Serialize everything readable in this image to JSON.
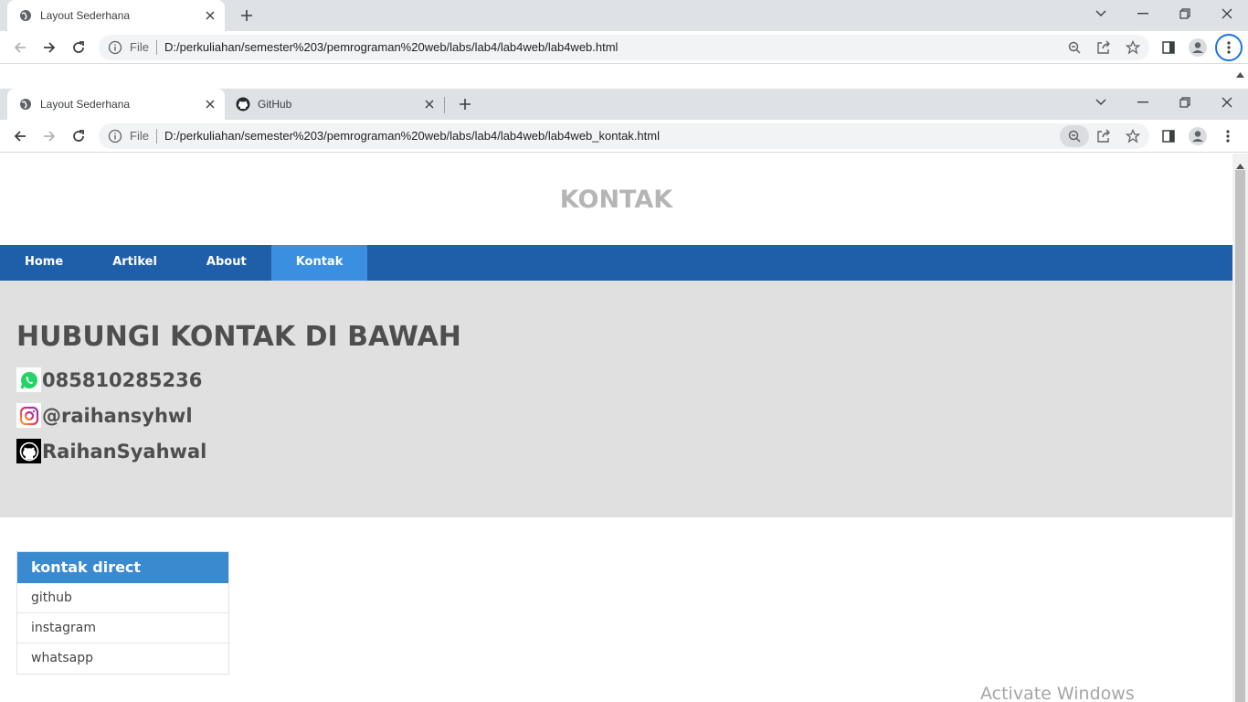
{
  "back_window": {
    "tab_title": "Layout Sederhana",
    "url_scheme": "File",
    "url": "D:/perkuliahan/semester%203/pemrograman%20web/labs/lab4/lab4web/lab4web.html"
  },
  "front_window": {
    "tabs": [
      {
        "title": "Layout Sederhana",
        "active": true,
        "icon": "globe-icon"
      },
      {
        "title": "GitHub",
        "active": false,
        "icon": "github-icon"
      }
    ],
    "url_scheme": "File",
    "url": "D:/perkuliahan/semester%203/pemrograman%20web/labs/lab4/lab4web/lab4web_kontak.html"
  },
  "page": {
    "header_title": "KONTAK",
    "nav": [
      {
        "label": "Home",
        "active": false
      },
      {
        "label": "Artikel",
        "active": false
      },
      {
        "label": "About",
        "active": false
      },
      {
        "label": "Kontak",
        "active": true
      }
    ],
    "hero": {
      "heading": "HUBUNGI KONTAK DI BAWAH",
      "contacts": [
        {
          "icon": "whatsapp-icon",
          "text": "085810285236"
        },
        {
          "icon": "instagram-icon",
          "text": "@raihansyhwl"
        },
        {
          "icon": "github-icon",
          "text": "RaihanSyahwal"
        }
      ]
    },
    "widget": {
      "title": "kontak direct",
      "items": [
        "github",
        "instagram",
        "whatsapp"
      ]
    }
  },
  "watermark": "Activate Windows",
  "colors": {
    "nav_bg": "#1f5faa",
    "nav_active": "#3a8fe0",
    "hero_bg": "#e0e0e0",
    "widget_head": "#3a8ad0",
    "header_text": "#b5b5b5"
  }
}
